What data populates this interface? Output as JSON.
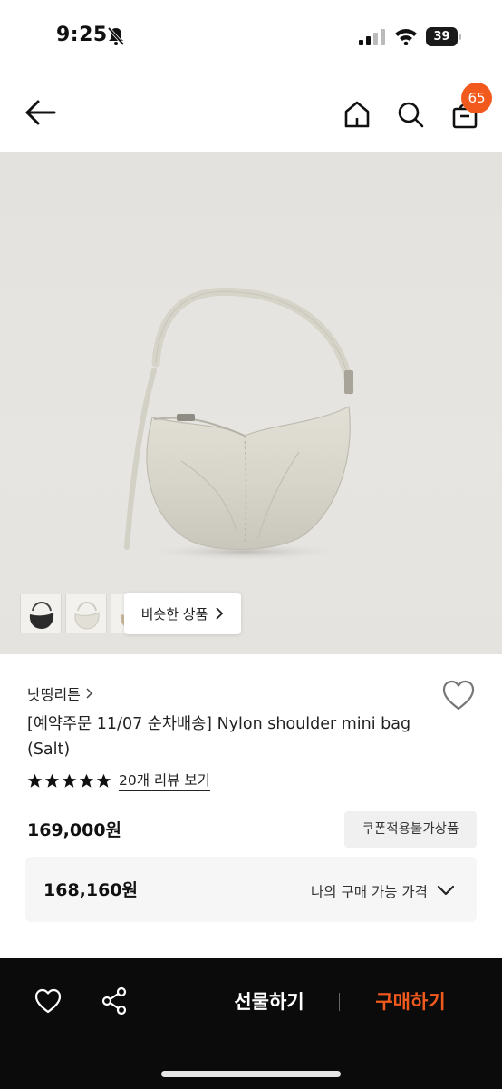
{
  "status_bar": {
    "time": "9:25",
    "battery": "39",
    "icons": [
      "bell-slash-icon",
      "signal-icon",
      "wifi-icon",
      "battery-icon"
    ]
  },
  "header": {
    "icons": [
      "back-arrow-icon",
      "home-icon",
      "search-icon",
      "shopping-bag-icon"
    ],
    "cart_count": "65"
  },
  "gallery": {
    "similar_label": "비슷한 상품",
    "thumbnails": [
      "black-bag-thumbnail",
      "white-bag-thumbnail",
      "beige-bag-thumbnail"
    ]
  },
  "product": {
    "brand": "낫띵리튼",
    "title": "[예약주문 11/07 순차배송] Nylon shoulder mini bag (Salt)",
    "rating_stars": 5,
    "review_link": "20개 리뷰 보기",
    "price": "169,000원",
    "coupon_badge": "쿠폰적용불가상품",
    "my_price": "168,160원",
    "my_price_label": "나의 구매 가능 가격"
  },
  "bottom_bar": {
    "gift_label": "선물하기",
    "buy_label": "구매하기",
    "icons": [
      "heart-icon",
      "share-icon"
    ]
  },
  "colors": {
    "accent": "#f25a1d",
    "bottom_bar_bg": "#0b0b0b",
    "image_bg": "#e5e3df"
  }
}
